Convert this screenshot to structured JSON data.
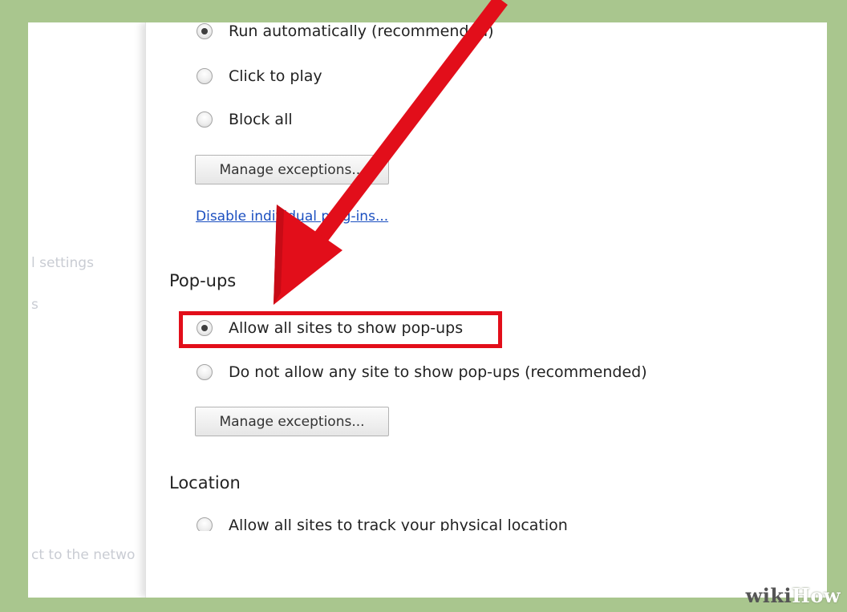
{
  "sidebar": {
    "items": [
      "l settings",
      "s",
      "ct to the netwo"
    ]
  },
  "plugins": {
    "options": [
      {
        "label": "Run automatically (recommended)",
        "checked": true
      },
      {
        "label": "Click to play",
        "checked": false
      },
      {
        "label": "Block all",
        "checked": false
      }
    ],
    "manage_button": "Manage exceptions...",
    "disable_link": "Disable individual plug-ins..."
  },
  "popups": {
    "title": "Pop-ups",
    "options": [
      {
        "label": "Allow all sites to show pop-ups",
        "checked": true
      },
      {
        "label": "Do not allow any site to show pop-ups (recommended)",
        "checked": false
      }
    ],
    "manage_button": "Manage exceptions..."
  },
  "location": {
    "title": "Location",
    "first_option_label": "Allow all sites to track your physical location"
  },
  "annotation": {
    "color": "#e20e1a"
  },
  "watermark": {
    "wiki": "wiki",
    "how": "How"
  }
}
